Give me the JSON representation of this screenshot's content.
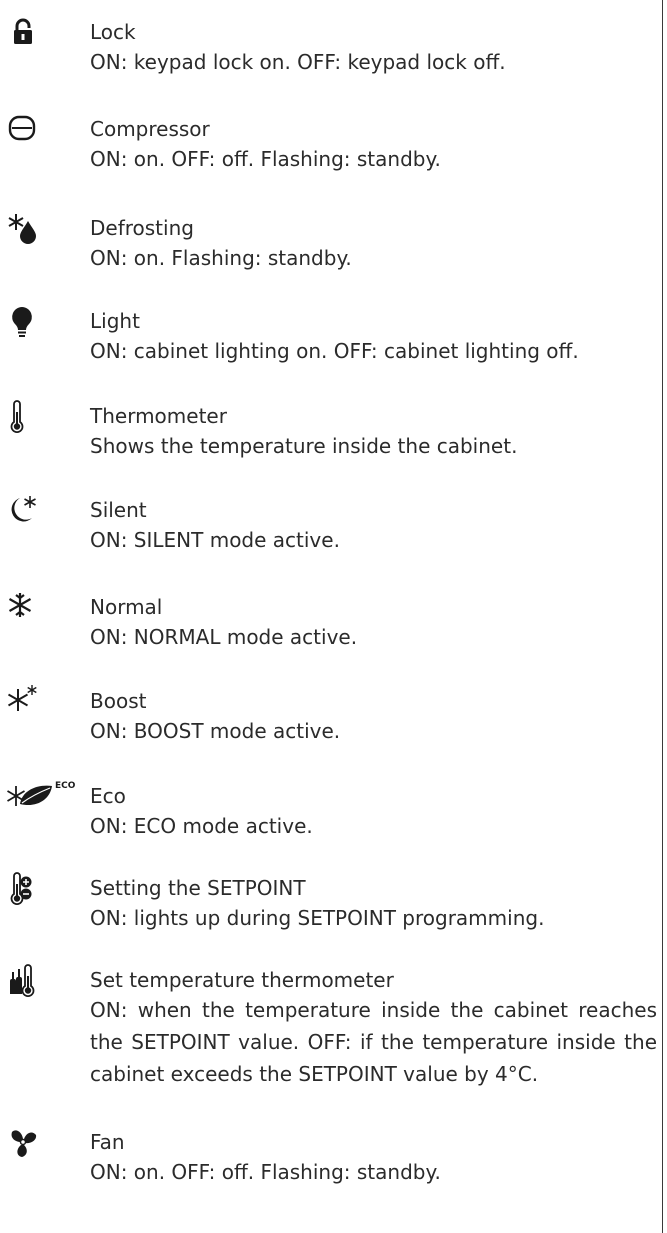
{
  "entries": [
    {
      "icon": "lock-icon",
      "title": "Lock",
      "desc": "ON: keypad lock on. OFF: keypad lock off."
    },
    {
      "icon": "compressor-icon",
      "title": "Compressor",
      "desc": "ON: on. OFF: off. Flashing: standby."
    },
    {
      "icon": "defrosting-icon",
      "title": "Defrosting",
      "desc": "ON: on. Flashing: standby."
    },
    {
      "icon": "light-bulb-icon",
      "title": "Light",
      "desc": "ON: cabinet lighting on. OFF: cabinet lighting off."
    },
    {
      "icon": "thermometer-icon",
      "title": "Thermometer",
      "desc": "Shows the temperature inside the cabinet."
    },
    {
      "icon": "silent-moon-icon",
      "title": "Silent",
      "desc": "ON: SILENT mode active."
    },
    {
      "icon": "snowflake-icon",
      "title": "Normal",
      "desc": "ON: NORMAL mode active."
    },
    {
      "icon": "boost-snowflake-icon",
      "title": "Boost",
      "desc": "ON: BOOST mode active."
    },
    {
      "icon": "eco-leaf-icon",
      "title": "Eco",
      "desc": "ON: ECO mode active.",
      "badge": "ECO"
    },
    {
      "icon": "setpoint-thermometer-icon",
      "title": "Setting the SETPOINT",
      "desc": "ON: lights up during SETPOINT programming."
    },
    {
      "icon": "bottles-thermometer-icon",
      "title": "Set temperature thermometer",
      "desc": "ON: when the temperature inside the cabinet reaches the SETPOINT value. OFF: if the temperature inside the cabinet exceeds the SETPOINT value by 4°C."
    },
    {
      "icon": "fan-icon",
      "title": "Fan",
      "desc": "ON: on. OFF: off. Flashing: standby."
    }
  ]
}
